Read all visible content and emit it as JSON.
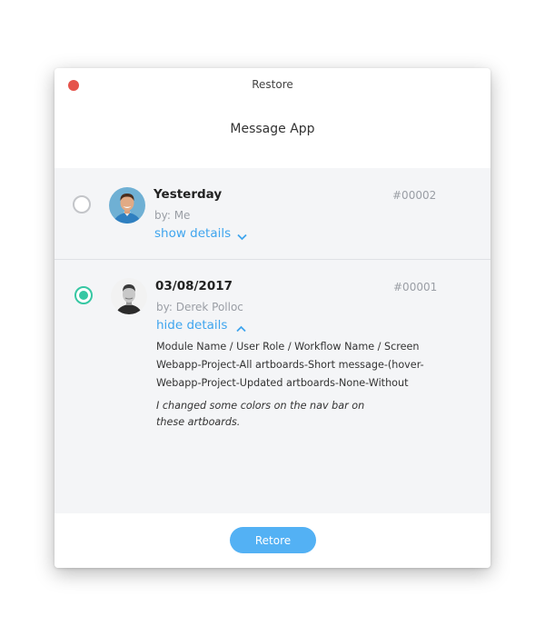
{
  "window": {
    "title": "Restore"
  },
  "app": {
    "title": "Message App"
  },
  "colors": {
    "accent": "#3fa5ee",
    "selected": "#36c7a3",
    "close": "#e5534b",
    "button": "#53b1f4"
  },
  "entries": [
    {
      "date": "Yesterday",
      "id": "#00002",
      "author": "by: Me",
      "toggle_label": "show details",
      "toggle_icon": "chevron-down-icon",
      "selected": false
    },
    {
      "date": "03/08/2017",
      "id": "#00001",
      "author": "by: Derek Polloc",
      "toggle_label": "hide details",
      "toggle_icon": "chevron-up-icon",
      "selected": true,
      "details": [
        "Module Name / User Role / Workflow Name / Screen",
        "Webapp-Project-All artboards-Short message-(hover-",
        "Webapp-Project-Updated artboards-None-Without"
      ],
      "note": "I changed some colors on the nav bar on these artboards."
    }
  ],
  "footer": {
    "restore_label": "Retore"
  }
}
